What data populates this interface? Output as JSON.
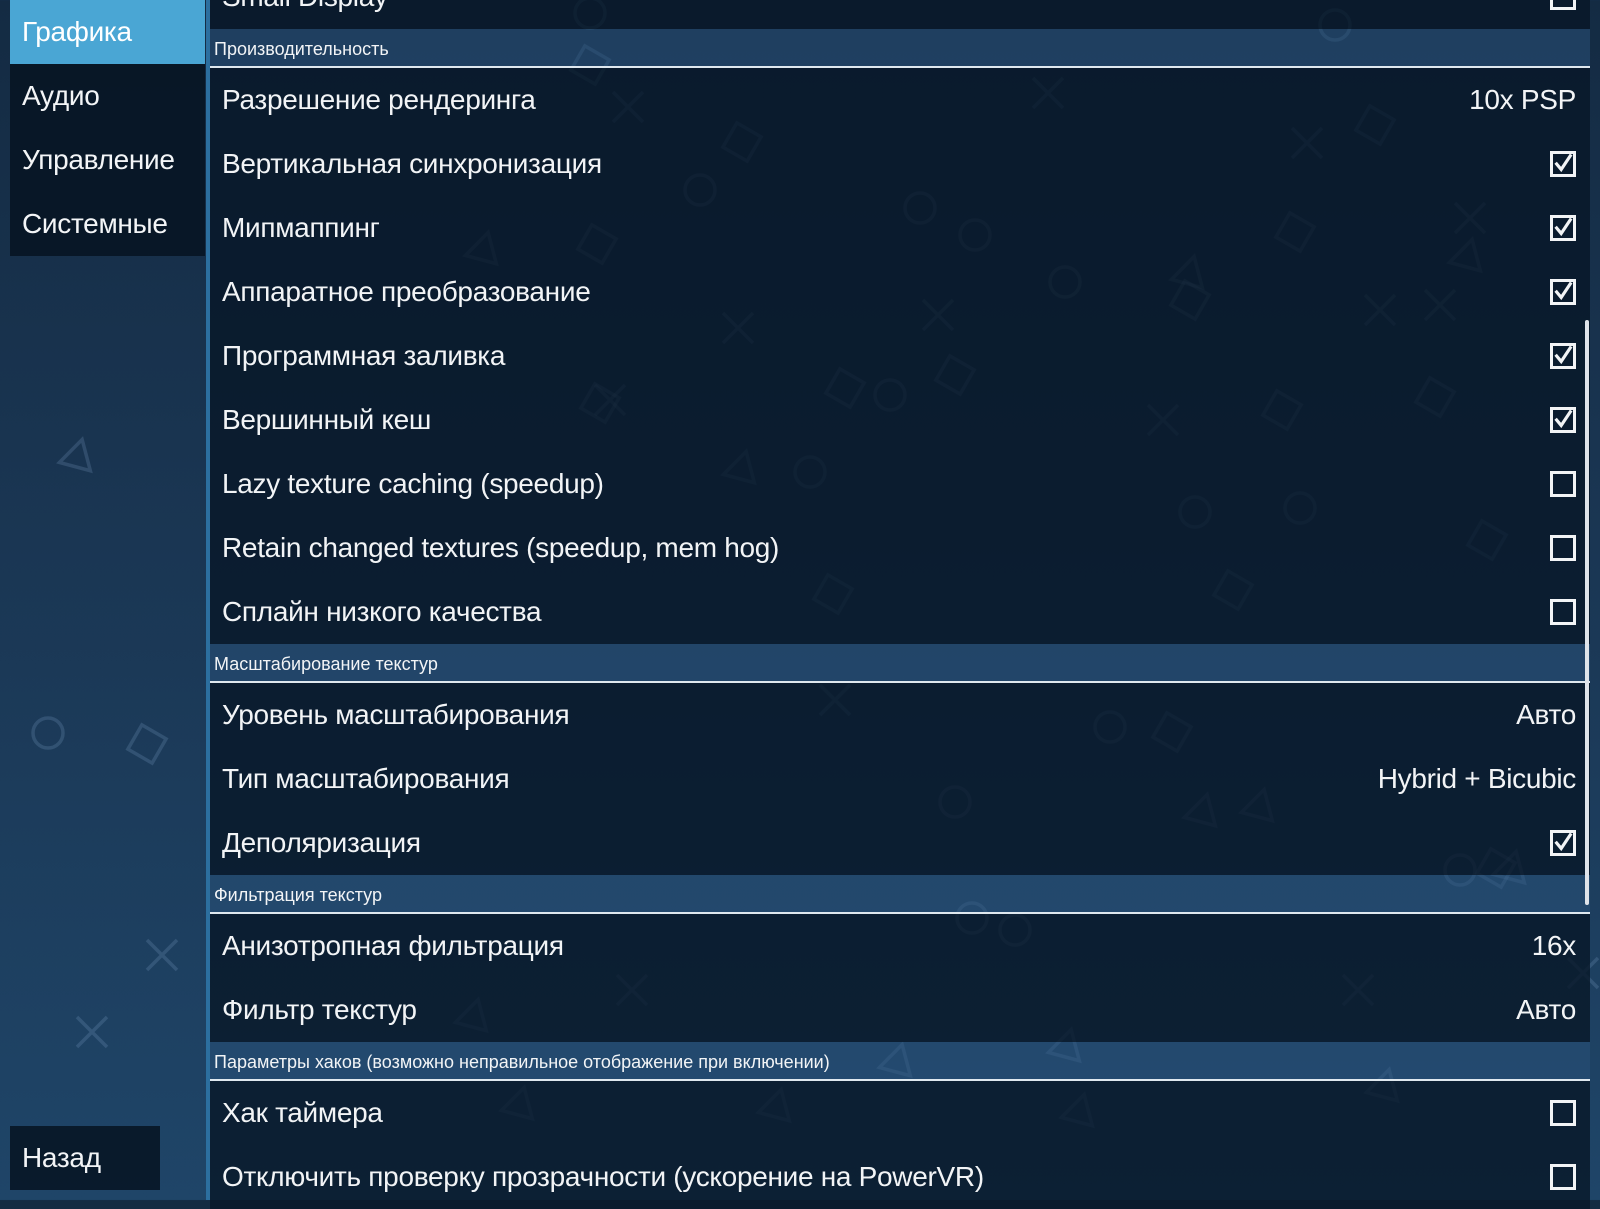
{
  "tabs": [
    {
      "label": "Графика",
      "active": true
    },
    {
      "label": "Аудио",
      "active": false
    },
    {
      "label": "Управление",
      "active": false
    },
    {
      "label": "Системные",
      "active": false
    }
  ],
  "back_label": "Назад",
  "top_item": {
    "label": "Small Display",
    "checked": false
  },
  "sections": [
    {
      "title": "Производительность",
      "items": [
        {
          "label": "Разрешение рендеринга",
          "value": "10x PSP"
        },
        {
          "label": "Вертикальная синхронизация",
          "checked": true
        },
        {
          "label": "Мипмаппинг",
          "checked": true
        },
        {
          "label": "Аппаратное преобразование",
          "checked": true
        },
        {
          "label": "Программная заливка",
          "checked": true
        },
        {
          "label": "Вершинный кеш",
          "checked": true
        },
        {
          "label": "Lazy texture caching (speedup)",
          "checked": false
        },
        {
          "label": "Retain changed textures (speedup, mem hog)",
          "checked": false
        },
        {
          "label": "Сплайн низкого качества",
          "checked": false
        }
      ]
    },
    {
      "title": "Масштабирование текстур",
      "items": [
        {
          "label": "Уровень масштабирования",
          "value": "Авто"
        },
        {
          "label": "Тип масштабирования",
          "value": "Hybrid + Bicubic"
        },
        {
          "label": "Деполяризация",
          "checked": true
        }
      ]
    },
    {
      "title": "Фильтрация текстур",
      "items": [
        {
          "label": "Анизотропная фильтрация",
          "value": "16x"
        },
        {
          "label": "Фильтр текстур",
          "value": "Авто"
        }
      ]
    },
    {
      "title": "Параметры хаков (возможно неправильное отображение при включении)",
      "items": [
        {
          "label": "Хак таймера",
          "checked": false
        },
        {
          "label": "Отключить проверку прозрачности (ускорение на PowerVR)",
          "checked": false
        }
      ]
    }
  ],
  "colors": {
    "accent": "#4aa6d4",
    "background": "#1a3653"
  },
  "icons": {
    "checkbox_checked": "checkmark-icon",
    "background_decor": "psp-shape-icons"
  }
}
